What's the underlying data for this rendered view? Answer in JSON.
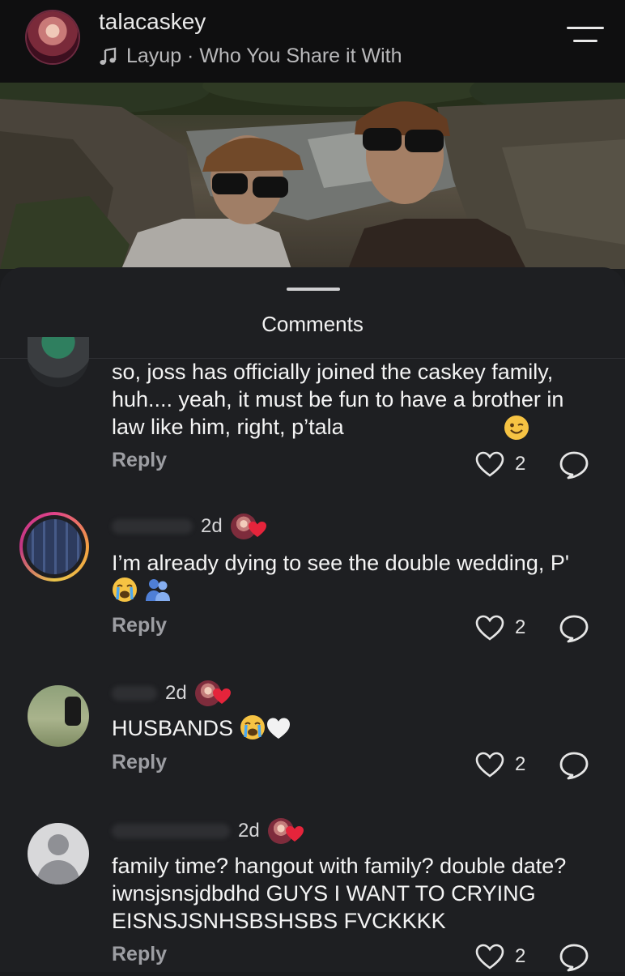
{
  "header": {
    "username": "talacaskey",
    "song": "Layup · Who You Share it With"
  },
  "sheet": {
    "title": "Comments"
  },
  "comments": [
    {
      "time": "",
      "text": "so, joss has officially joined the caskey family, huh.... yeah, it must be fun to have a brother in law like him, right, p’tala",
      "reply_label": "Reply",
      "likes": "2"
    },
    {
      "time": "2d",
      "text": "I’m already dying to see the double wedding, P'",
      "reply_label": "Reply",
      "likes": "2"
    },
    {
      "time": "2d",
      "text": "HUSBANDS",
      "reply_label": "Reply",
      "likes": "2"
    },
    {
      "time": "2d",
      "text": "family time? hangout with family? double date? iwnsjsnsjdbdhd GUYS I WANT TO CRYING EISNSJSNHSBSHSBS FVCKKKK",
      "reply_label": "Reply",
      "likes": "2"
    }
  ],
  "colors": {
    "background": "#1e1f22",
    "heart_red": "#e5243b",
    "reply_gray": "#9d9ea3",
    "story_ring": "#e0428a"
  },
  "icons": {
    "menu": "menu-icon",
    "music": "music-note-icon",
    "like": "heart-outline-icon",
    "share": "share-icon"
  }
}
